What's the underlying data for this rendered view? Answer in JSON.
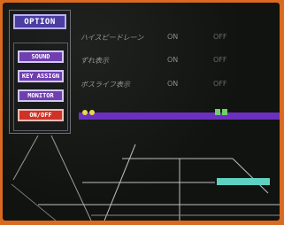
{
  "title": "OPTION",
  "menu": [
    {
      "label": "SOUND"
    },
    {
      "label": "KEY ASSIGN"
    },
    {
      "label": "MONITOR"
    },
    {
      "label": "ON/OFF"
    }
  ],
  "options": [
    {
      "label": "ハイスピードレーン",
      "on": "ON",
      "off": "OFF"
    },
    {
      "label": "ずれ表示",
      "on": "ON",
      "off": "OFF"
    },
    {
      "label": "ボスライフ表示",
      "on": "ON",
      "off": "OFF"
    }
  ],
  "colors": {
    "border": "#d96a1f",
    "menu_button": "#6f3fb0",
    "menu_button_active": "#cf3327",
    "track": "#6d2fc0",
    "platform": "#5fd1c0"
  }
}
